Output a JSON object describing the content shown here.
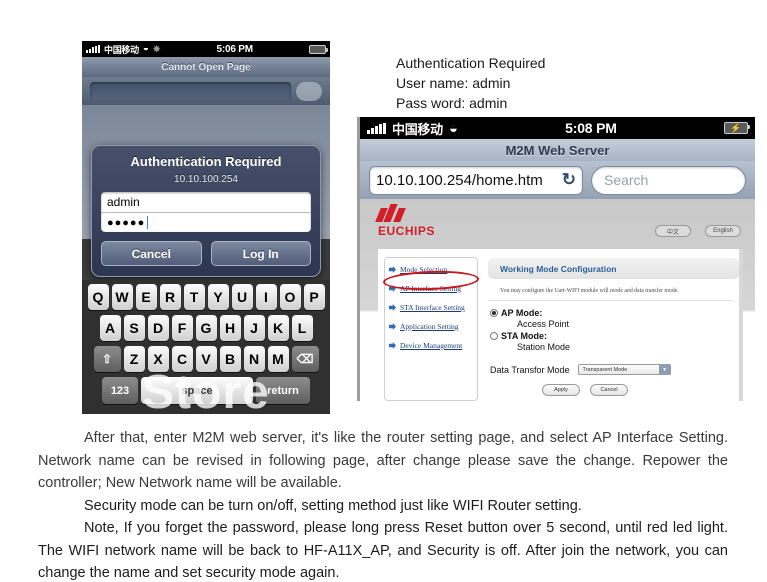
{
  "phone1": {
    "statusbar": {
      "signal_icon": "signal-bars-icon",
      "carrier": "中国移动",
      "wifi_icon": "wifi-icon",
      "activity_icon": "spinner-icon",
      "time": "5:06 PM",
      "battery_icon": "battery-icon"
    },
    "nav_title": "Cannot Open Page",
    "dialog": {
      "title": "Authentication Required",
      "host": "10.10.100.254",
      "username_value": "admin",
      "password_value": "●●●●●",
      "cancel_label": "Cancel",
      "login_label": "Log In"
    },
    "keyboard": {
      "row1": [
        "Q",
        "W",
        "E",
        "R",
        "T",
        "Y",
        "U",
        "I",
        "O",
        "P"
      ],
      "row2": [
        "A",
        "S",
        "D",
        "F",
        "G",
        "H",
        "J",
        "K",
        "L"
      ],
      "row3": [
        "Z",
        "X",
        "C",
        "V",
        "B",
        "N",
        "M"
      ],
      "shift_icon": "shift-arrow-icon",
      "delete_icon": "backspace-icon",
      "numeric_label": "123",
      "space_label": "space",
      "return_label": "return"
    },
    "watermark": "Store"
  },
  "annotation": {
    "line1": "Authentication Required",
    "line2": "User name: admin",
    "line3": "Pass word: admin"
  },
  "phone2": {
    "statusbar": {
      "signal_icon": "signal-bars-icon",
      "carrier": "中国移动",
      "wifi_icon": "wifi-icon",
      "time": "5:08 PM",
      "battery_icon": "battery-charging-icon"
    },
    "nav_title": "M2M Web Server",
    "url_value": "10.10.100.254/home.htm",
    "reload_icon": "reload-icon",
    "search_placeholder": "Search",
    "web": {
      "logo_text": "EUCHIPS",
      "logo_icon": "euchips-bars-logo",
      "lang_cn": "中文",
      "lang_en": "English",
      "nav_items": [
        {
          "label": "Mode Selection",
          "highlighted": false
        },
        {
          "label": "AP Interface Setting",
          "highlighted": true
        },
        {
          "label": "STA Interface Setting",
          "highlighted": false
        },
        {
          "label": "Application Setting",
          "highlighted": false
        },
        {
          "label": "Device Management",
          "highlighted": false
        }
      ],
      "panel_title": "Working Mode Configuration",
      "panel_desc": "You may configure the Uart-WIFI module will mode and data transfer mode.",
      "ap_mode_label": "AP Mode:",
      "ap_mode_sub": "Access Point",
      "sta_mode_label": "STA Mode:",
      "sta_mode_sub": "Station Mode",
      "data_transfer_label": "Data Transfor Mode",
      "data_transfer_value": "Transparent Mode",
      "apply_label": "Apply",
      "cancel_label": "Cancel"
    }
  },
  "paragraphs": {
    "p1": "After that, enter M2M web server, it's like the router setting page, and select AP Interface Setting. Network name can be revised in following page, after change please save the change. Repower the controller; New Network name will be available.",
    "p2": "Security mode can be turn on/off, setting method just like WIFI Router setting.",
    "p3": "Note, If you forget the password, please long press Reset button over 5 second, until red led light. The WIFI network name will be back to HF-A11X_AP, and Security is off. After join the network, you can change the name and set security mode again."
  },
  "colors": {
    "brand_red": "#d01f26",
    "panel_blue": "#2a6099",
    "link_blue": "#1b3d72",
    "highlight_red": "#c8161d"
  }
}
